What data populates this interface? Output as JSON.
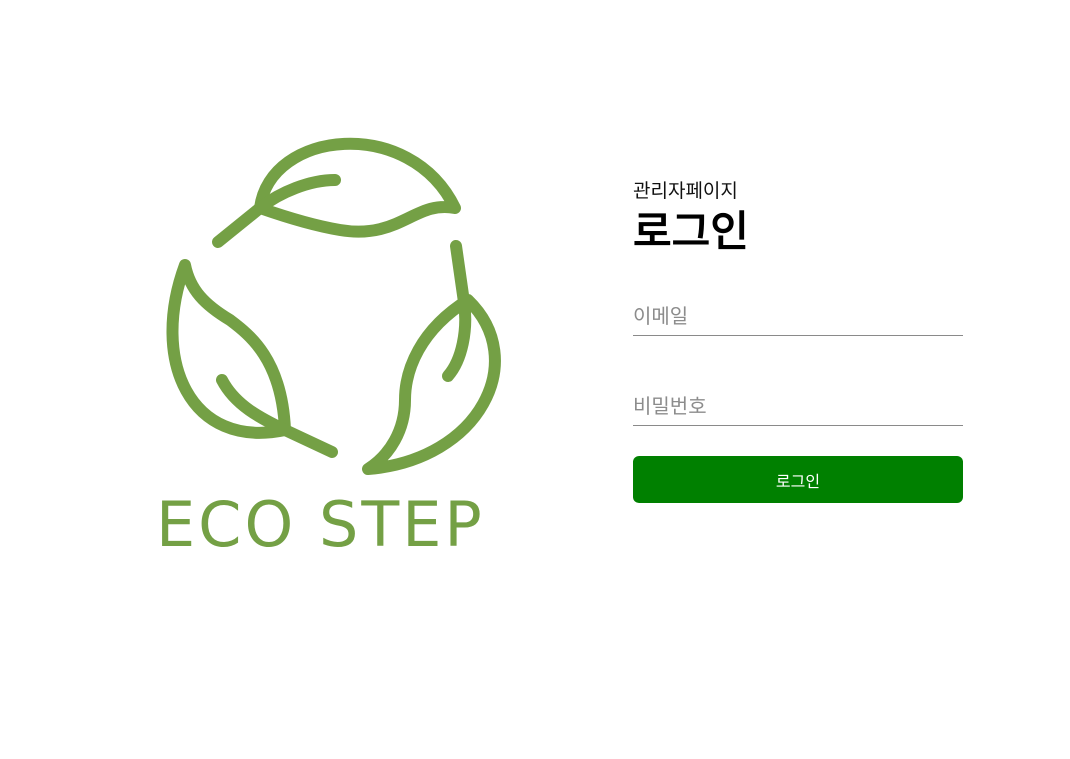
{
  "brand": {
    "logo_text": "ECO STEP",
    "logo_icon": "recycle-leaves-icon",
    "color": "#74a045"
  },
  "login": {
    "subtitle": "관리자페이지",
    "title": "로그인",
    "email_placeholder": "이메일",
    "password_placeholder": "비밀번호",
    "button_label": "로그인",
    "button_color": "#008000"
  }
}
